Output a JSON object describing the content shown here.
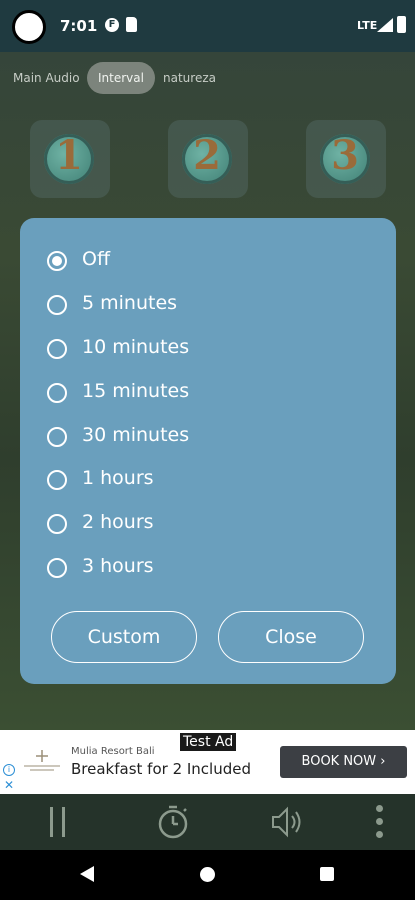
{
  "status_bar": {
    "time": "7:01",
    "network": "LTE",
    "notification_icons": [
      "app-f-icon",
      "sd-card-icon"
    ]
  },
  "tabs": [
    {
      "label": "Main Audio",
      "selected": false
    },
    {
      "label": "Interval",
      "selected": true
    },
    {
      "label": "natureza",
      "selected": false
    }
  ],
  "number_tiles": [
    "1",
    "2",
    "3"
  ],
  "dialog": {
    "options": [
      {
        "label": "Off",
        "checked": true
      },
      {
        "label": "5 minutes",
        "checked": false
      },
      {
        "label": "10 minutes",
        "checked": false
      },
      {
        "label": "15 minutes",
        "checked": false
      },
      {
        "label": "30 minutes",
        "checked": false
      },
      {
        "label": "1 hours",
        "checked": false
      },
      {
        "label": "2 hours",
        "checked": false
      },
      {
        "label": "3 hours",
        "checked": false
      }
    ],
    "custom_label": "Custom",
    "close_label": "Close",
    "background_color": "#6a9fbd"
  },
  "ad": {
    "tag": "Test Ad",
    "advertiser": "Mulia Resort Bali",
    "headline": "Breakfast for 2 Included",
    "cta": "BOOK NOW ›"
  },
  "controls": {
    "icons": [
      "pause-icon",
      "timer-icon",
      "volume-icon",
      "more-vert-icon"
    ]
  },
  "colors": {
    "status_bar": "#1f3a40",
    "controls_bar": "#25332a",
    "ad_cta": "#3c3f44"
  }
}
